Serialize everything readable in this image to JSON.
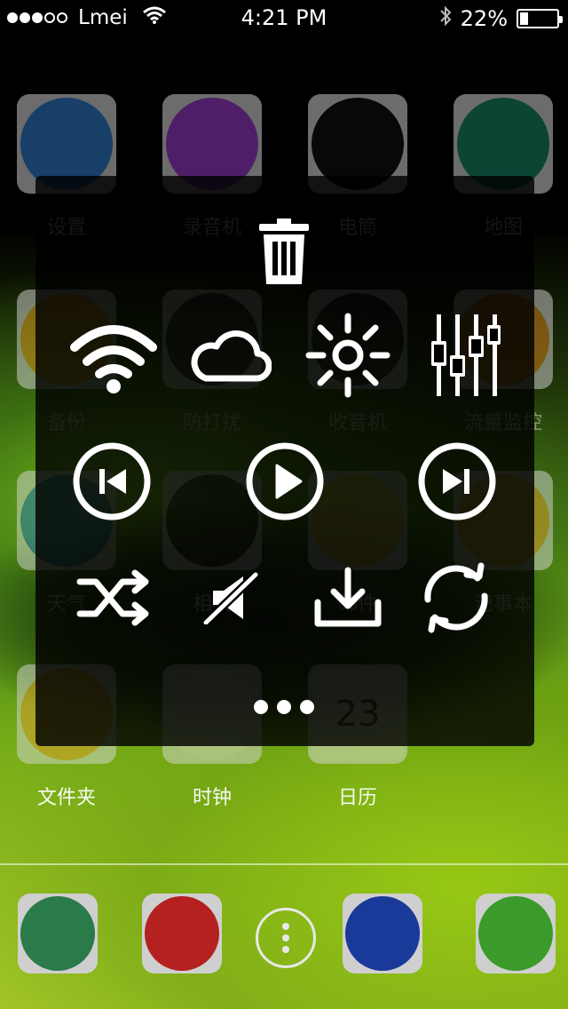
{
  "status_bar": {
    "signal_dots_filled": 3,
    "signal_dots_total": 5,
    "carrier": "Lmei",
    "time": "4:21 PM",
    "battery_text": "22%",
    "battery_level": 0.22
  },
  "home_apps": [
    {
      "label": "设置",
      "icon": "settings-icon",
      "color": "#2e7fd0"
    },
    {
      "label": "录音机",
      "icon": "microphone-icon",
      "color": "#9b3fcf"
    },
    {
      "label": "电筒",
      "icon": "flashlight-icon",
      "color": "#111111"
    },
    {
      "label": "地图",
      "icon": "map-pin-icon",
      "color": "#1a8a6a"
    },
    {
      "label": "备份",
      "icon": "backup-icon",
      "color": "#e8a020"
    },
    {
      "label": "防打扰",
      "icon": "do-not-disturb-icon",
      "color": "#333333"
    },
    {
      "label": "收音机",
      "icon": "radio-icon",
      "color": "#2a2a2a"
    },
    {
      "label": "流量监控",
      "icon": "data-monitor-icon",
      "color": "#e08a20"
    },
    {
      "label": "天气",
      "icon": "weather-icon",
      "color": "#2a7ab8"
    },
    {
      "label": "相机",
      "icon": "camera-icon",
      "color": "#222222"
    },
    {
      "label": "邮件",
      "icon": "mail-icon",
      "color": "#e8c040"
    },
    {
      "label": "记事本",
      "icon": "notepad-icon",
      "color": "#e8a030"
    },
    {
      "label": "文件夹",
      "icon": "folder-icon",
      "color": "#e8a030"
    },
    {
      "label": "时钟",
      "icon": "clock-icon",
      "color": "#e0e0e0"
    },
    {
      "label": "日历",
      "icon": "calendar-icon",
      "color": "#e0e0e0",
      "badge": "23"
    }
  ],
  "dock_apps": [
    {
      "icon": "phone-icon",
      "color": "#2a7a4a"
    },
    {
      "icon": "contacts-icon",
      "color": "#b52020"
    },
    {
      "icon": "more-vertical-icon",
      "color": "#ffffff"
    },
    {
      "icon": "music-icon",
      "color": "#1a3a9a"
    },
    {
      "icon": "messages-icon",
      "color": "#3a9a2a"
    }
  ],
  "panel_controls": [
    {
      "row": 0,
      "icon": "trash-icon"
    },
    {
      "row": 1,
      "icon": "wifi-icon"
    },
    {
      "row": 1,
      "icon": "cloud-icon"
    },
    {
      "row": 1,
      "icon": "brightness-icon"
    },
    {
      "row": 1,
      "icon": "equalizer-icon"
    },
    {
      "row": 2,
      "icon": "previous-track-icon"
    },
    {
      "row": 2,
      "icon": "play-icon"
    },
    {
      "row": 2,
      "icon": "next-track-icon"
    },
    {
      "row": 3,
      "icon": "shuffle-icon"
    },
    {
      "row": 3,
      "icon": "mute-icon"
    },
    {
      "row": 3,
      "icon": "download-icon"
    },
    {
      "row": 3,
      "icon": "refresh-icon"
    },
    {
      "row": 4,
      "icon": "more-horizontal-icon"
    }
  ]
}
